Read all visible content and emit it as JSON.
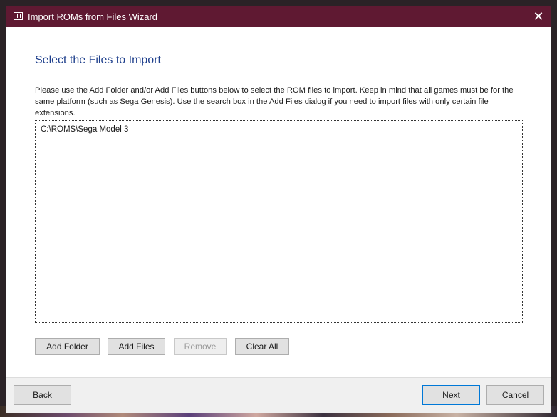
{
  "window": {
    "title": "Import ROMs from Files Wizard",
    "close_glyph": "✕",
    "icon": "app-icon",
    "accent_color": "#5f1932"
  },
  "page": {
    "heading": "Select the Files to Import",
    "heading_color": "#1e3f8c",
    "description": "Please use the Add Folder and/or Add Files buttons below to select the ROM files to import. Keep in mind that all games must be for the same platform (such as Sega Genesis). Use the search box in the Add Files dialog if you need to import files with only certain file extensions."
  },
  "file_list": {
    "items": [
      "C:\\ROMS\\Sega Model 3"
    ]
  },
  "list_buttons": {
    "add_folder": "Add Folder",
    "add_files": "Add Files",
    "remove": "Remove",
    "clear_all": "Clear All"
  },
  "nav_buttons": {
    "back": "Back",
    "next": "Next",
    "cancel": "Cancel"
  }
}
